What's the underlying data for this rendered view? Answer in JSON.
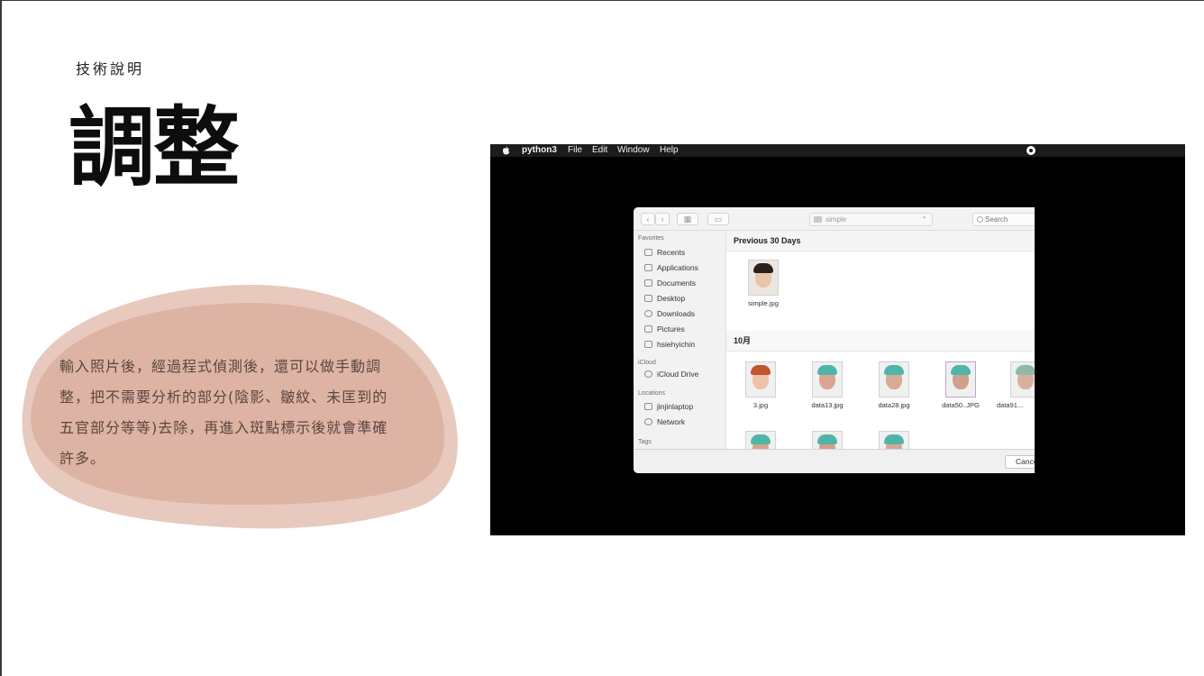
{
  "slide": {
    "kicker": "技術說明",
    "title": "調整",
    "body": "輸入照片後，經過程式偵測後，還可以做手動調整，把不需要分析的部分(陰影、皺紋、未匡到的五官部分等等)去除，再進入斑點標示後就會準確許多。"
  },
  "menubar": {
    "app": "python3",
    "items": [
      "File",
      "Edit",
      "Window",
      "Help"
    ]
  },
  "dialog": {
    "path": "simple",
    "search_placeholder": "Search",
    "sidebar": {
      "favorites_heading": "Favorites",
      "favorites": [
        "Recents",
        "Applications",
        "Documents",
        "Desktop",
        "Downloads",
        "Pictures",
        "hsiehyichin"
      ],
      "icloud_heading": "iCloud",
      "icloud": [
        "iCloud Drive"
      ],
      "locations_heading": "Locations",
      "locations": [
        "jinjinlaptop",
        "Network"
      ],
      "tags_heading": "Tags"
    },
    "groups": [
      {
        "title": "Previous 30 Days",
        "files": [
          "simple.jpg"
        ]
      },
      {
        "title": "10月",
        "files": [
          "3.jpg",
          "data13.jpg",
          "data28.jpg",
          "data50..JPG",
          "data91..."
        ]
      }
    ],
    "cancel_label": "Cancel"
  },
  "colors": {
    "blob_back": "#e8c9bd",
    "blob_front": "#ddb3a3",
    "surgical_cap": "#4fb5aa"
  }
}
